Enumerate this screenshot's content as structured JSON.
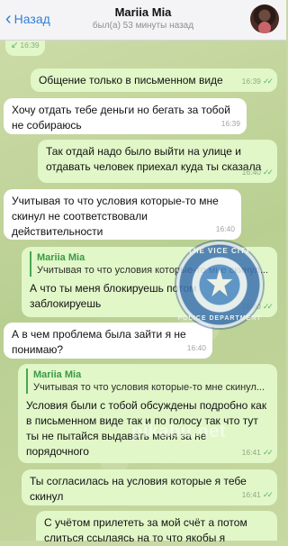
{
  "header": {
    "back_label": "Назад",
    "contact_name": "Mariia Mia",
    "last_seen": "был(а) 53 минуты назад"
  },
  "messages": [
    {
      "dir": "out",
      "text": "",
      "time": "16:39"
    },
    {
      "dir": "out",
      "text": "Общение только в письменном виде",
      "time": "16:39"
    },
    {
      "dir": "in",
      "text": "Хочу отдать тебе деньги но бегать за тобой не собираюсь",
      "time": "16:39"
    },
    {
      "dir": "out",
      "text": "Так отдай надо было выйти на улице и отдавать человек приехал куда ты сказала",
      "time": "16:40"
    },
    {
      "dir": "in",
      "text": "Учитывая то что условия которые-то мне скинул не соответствовали действительности",
      "time": "16:40"
    },
    {
      "dir": "out",
      "reply_name": "Mariia Mia",
      "reply_text": "Учитывая то что условия которые-то мне скинул...",
      "text": "А что ты меня блокируешь потом заблокируешь",
      "time": "16:40"
    },
    {
      "dir": "in",
      "text": "А в чем проблема была зайти я не понимаю?",
      "time": "16:40"
    },
    {
      "dir": "out",
      "reply_name": "Mariia Mia",
      "reply_text": "Учитывая то что условия которые-то мне скинул...",
      "text": "Условия были с тобой обсуждены подробно как в письменном виде так и по голосу так что тут ты не пытайся выдавать меня за не порядочного",
      "time": "16:41"
    },
    {
      "dir": "out",
      "text": "Ты согласилась на условия которые я тебе скинул",
      "time": "16:41"
    },
    {
      "dir": "out",
      "text": "С учётом прилететь за мой счёт а потом слиться ссылаясь на то что якобы я",
      "time": ""
    }
  ],
  "watermark": {
    "seal_top": "THE VICE CITY",
    "seal_bottom": "POLICE DEPARTMENT",
    "site": "pikabu.net"
  },
  "colors": {
    "accent": "#2f7fd8",
    "outgoing_bubble": "#e1f7c8",
    "incoming_bubble": "#ffffff",
    "reply_bar": "#4aa655"
  }
}
